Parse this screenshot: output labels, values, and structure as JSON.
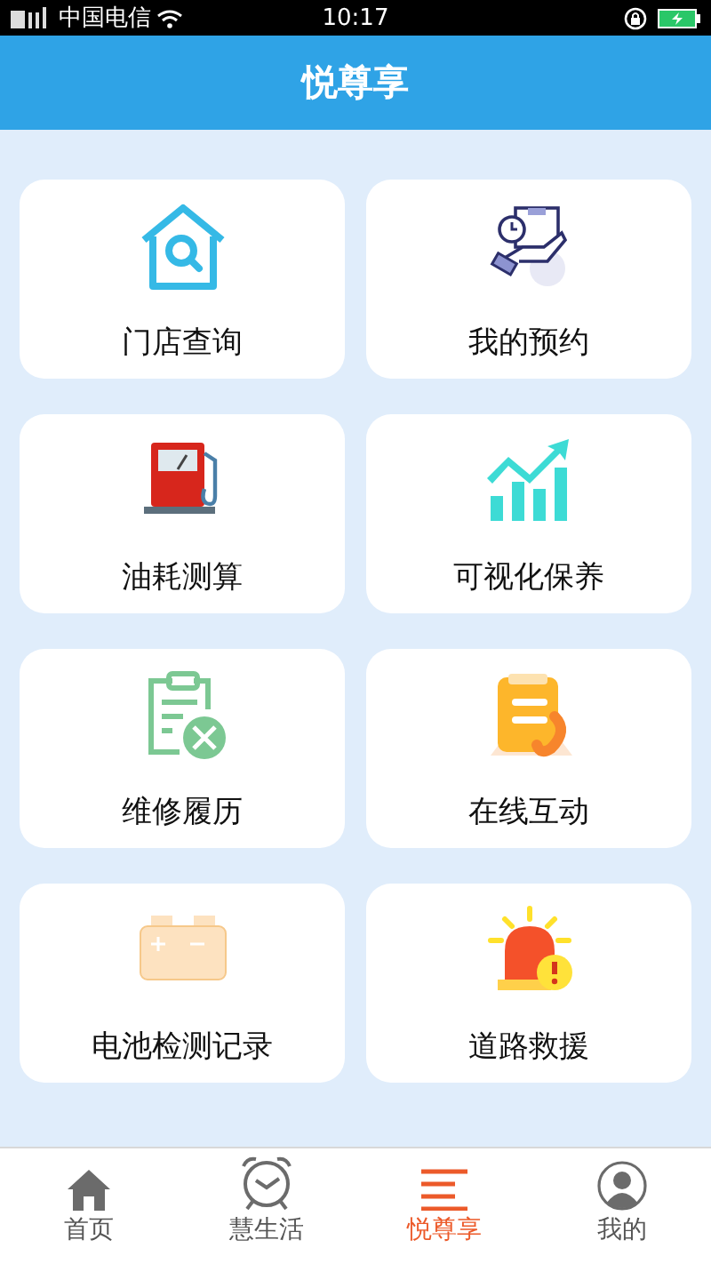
{
  "status_bar": {
    "carrier": "中国电信",
    "time": "10:17"
  },
  "header": {
    "title": "悦尊享"
  },
  "cards": [
    {
      "label": "门店查询",
      "kind": "store"
    },
    {
      "label": "我的预约",
      "kind": "appointment"
    },
    {
      "label": "油耗测算",
      "kind": "fuel"
    },
    {
      "label": "可视化保养",
      "kind": "chart"
    },
    {
      "label": "维修履历",
      "kind": "repair"
    },
    {
      "label": "在线互动",
      "kind": "call"
    },
    {
      "label": "电池检测记录",
      "kind": "battery"
    },
    {
      "label": "道路救援",
      "kind": "alarm"
    }
  ],
  "tab_bar": [
    {
      "label": "首页",
      "kind": "home",
      "selected": false
    },
    {
      "label": "慧生活",
      "kind": "clock",
      "selected": false
    },
    {
      "label": "悦尊享",
      "kind": "list",
      "selected": true
    },
    {
      "label": "我的",
      "kind": "user",
      "selected": false
    }
  ]
}
